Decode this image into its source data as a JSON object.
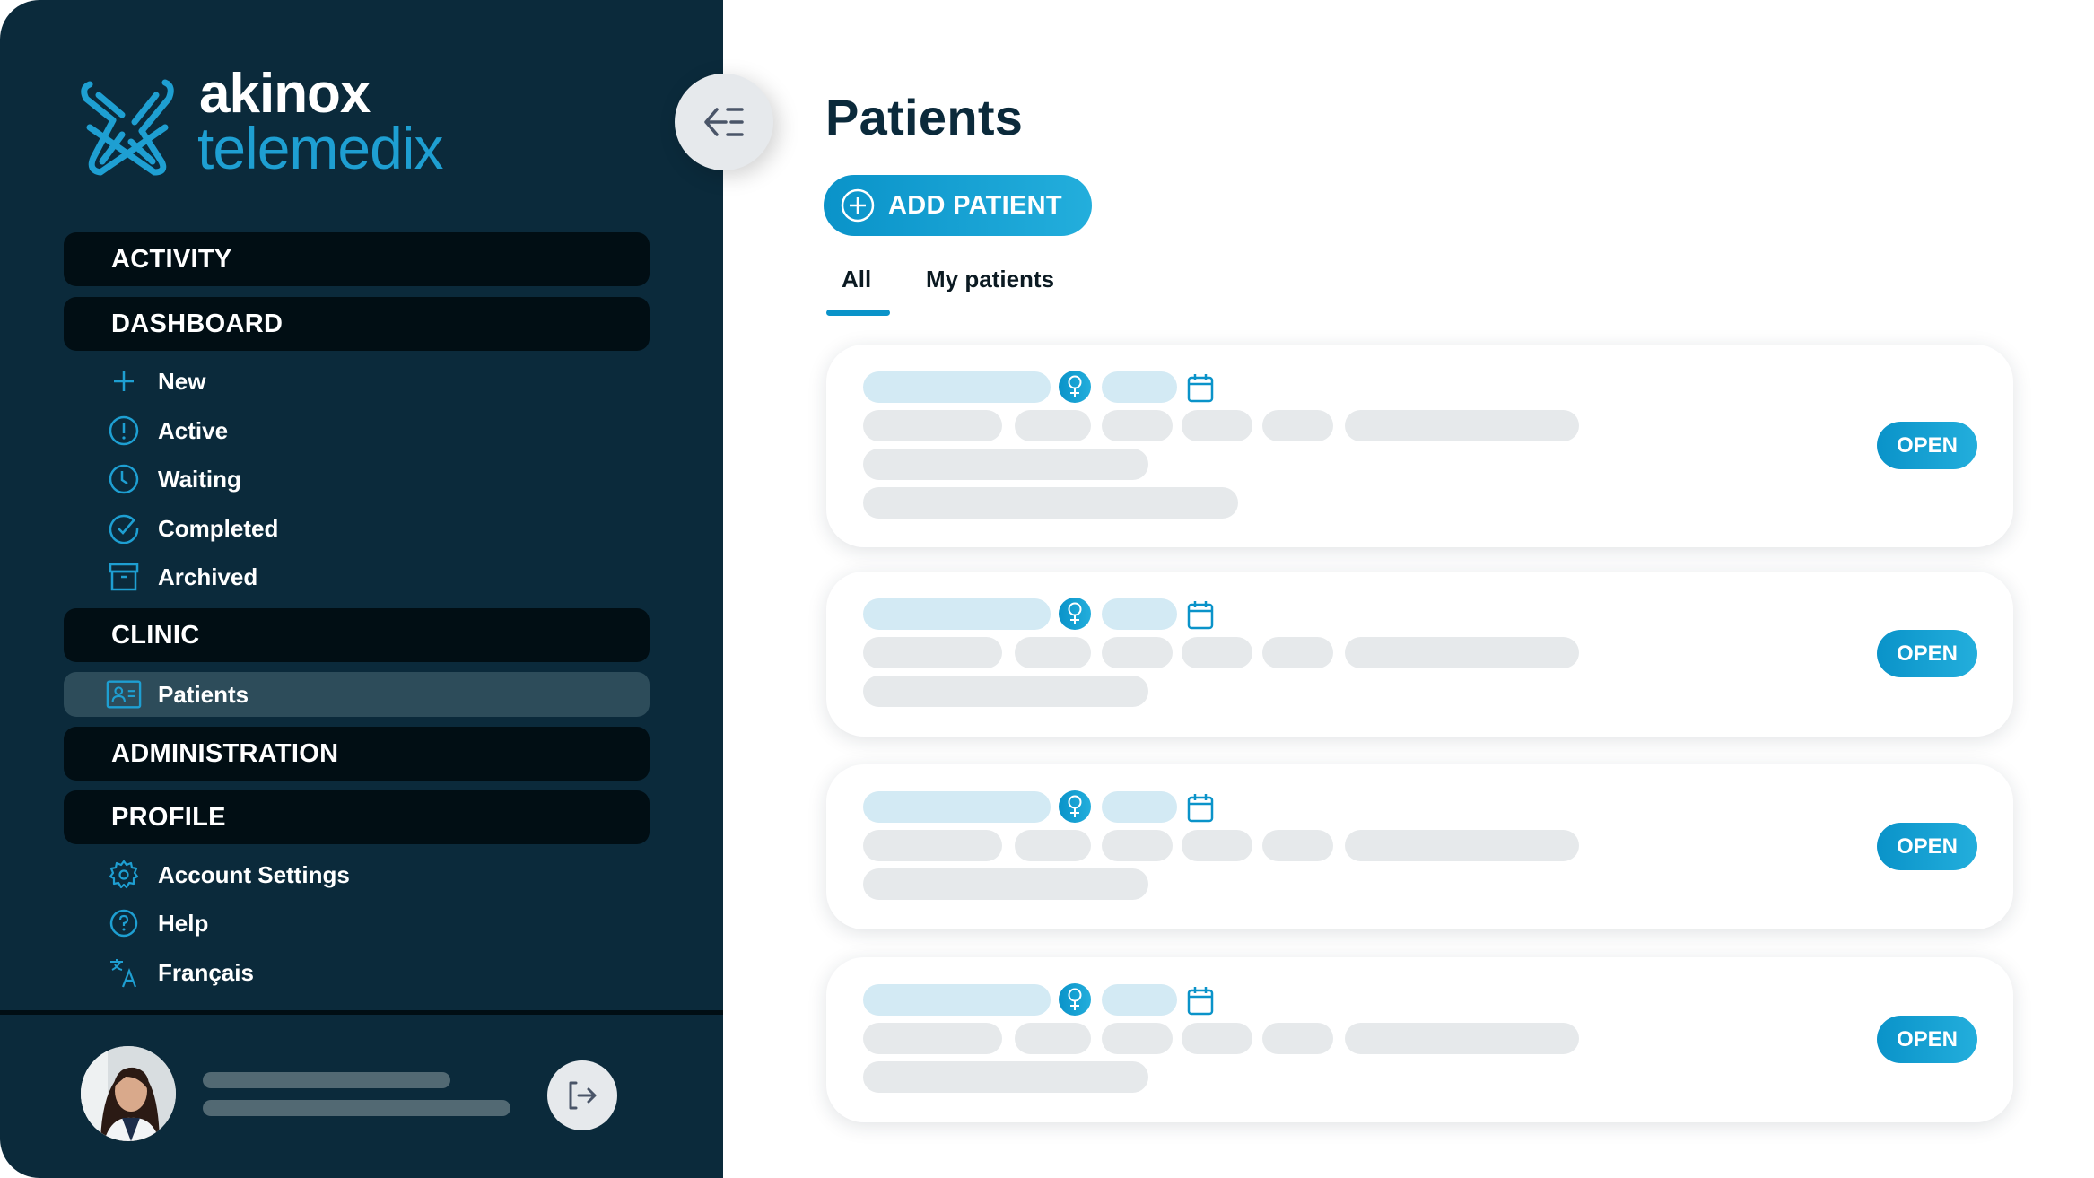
{
  "brand": {
    "name_line1": "akinox",
    "name_line2": "telemedix",
    "accent_color": "#1e9fd2",
    "sidebar_bg": "#0b2a3b"
  },
  "sidebar": {
    "collapse_icon": "collapse-menu-icon",
    "sections": [
      {
        "label": "ACTIVITY",
        "items": []
      },
      {
        "label": "DASHBOARD",
        "items": [
          {
            "label": "New",
            "icon": "plus-icon"
          },
          {
            "label": "Active",
            "icon": "alert-circle-icon"
          },
          {
            "label": "Waiting",
            "icon": "clock-icon"
          },
          {
            "label": "Completed",
            "icon": "check-circle-icon"
          },
          {
            "label": "Archived",
            "icon": "archive-box-icon"
          }
        ]
      },
      {
        "label": "CLINIC",
        "items": [
          {
            "label": "Patients",
            "icon": "patient-card-icon",
            "selected": true
          }
        ]
      },
      {
        "label": "ADMINISTRATION",
        "items": []
      },
      {
        "label": "PROFILE",
        "items": [
          {
            "label": "Account Settings",
            "icon": "gear-icon"
          },
          {
            "label": "Help",
            "icon": "help-circle-icon"
          },
          {
            "label": "Français",
            "icon": "translate-icon"
          }
        ]
      }
    ],
    "user": {
      "avatar": "user-avatar-photo",
      "logout_icon": "logout-icon"
    }
  },
  "main": {
    "title": "Patients",
    "add_button_label": "ADD PATIENT",
    "tabs": [
      {
        "label": "All",
        "active": true
      },
      {
        "label": "My patients",
        "active": false
      }
    ],
    "patients": [
      {
        "gender_icon": "female-icon",
        "open_label": "OPEN",
        "extra_lines": 2
      },
      {
        "gender_icon": "female-icon",
        "open_label": "OPEN",
        "extra_lines": 1
      },
      {
        "gender_icon": "female-icon",
        "open_label": "OPEN",
        "extra_lines": 1
      },
      {
        "gender_icon": "female-icon",
        "open_label": "OPEN",
        "extra_lines": 1
      }
    ]
  }
}
